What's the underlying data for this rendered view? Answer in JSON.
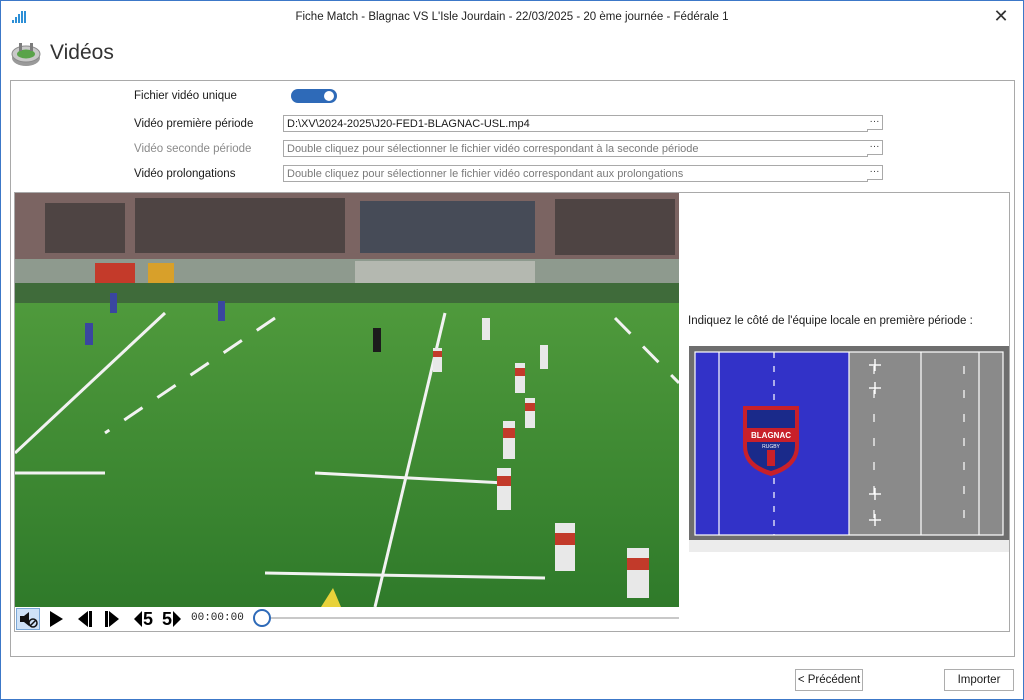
{
  "window": {
    "title": "Fiche Match - Blagnac VS L'Isle Jourdain - 22/03/2025 - 20 ème journée - Fédérale 1",
    "close_glyph": "✕"
  },
  "header": {
    "title": "Vidéos",
    "icon": "stadium-icon"
  },
  "form": {
    "single_file_label": "Fichier vidéo unique",
    "single_file_on": true,
    "first_half_label": "Vidéo première période",
    "first_half_value": "D:\\XV\\2024-2025\\J20-FED1-BLAGNAC-USL.mp4",
    "second_half_label": "Vidéo seconde période",
    "second_half_placeholder": "Double cliquez pour sélectionner le fichier vidéo correspondant à la seconde période",
    "extra_time_label": "Vidéo prolongations",
    "extra_time_placeholder": "Double cliquez pour sélectionner le fichier vidéo correspondant aux prolongations",
    "browse_label": "···"
  },
  "player": {
    "time": "00:00:00",
    "progress": 0,
    "back5_label": "5",
    "fwd5_label": "5"
  },
  "side": {
    "prompt": "Indiquez le côté de l'équipe locale en première période :",
    "team_logo_text": "BLAGNAC",
    "team_logo_sub": "RUGBY",
    "home_side": "left",
    "home_color": "#3232c8",
    "pitch_color": "#6e6e6e"
  },
  "footer": {
    "previous_label": "< Précédent",
    "import_label": "Importer"
  }
}
